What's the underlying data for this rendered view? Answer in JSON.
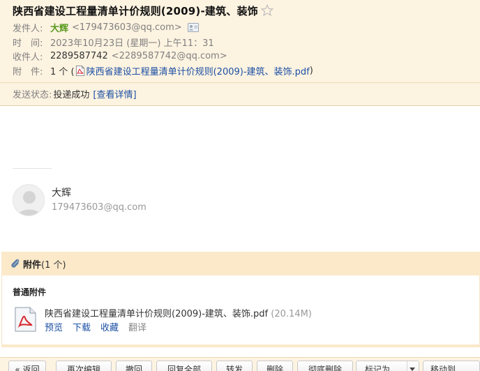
{
  "mail": {
    "subject": "陕西省建设工程量清单计价规则(2009)-建筑、装饰",
    "sender_label": "发件人:",
    "sender_name": "大辉",
    "sender_email": "<179473603@qq.com>",
    "time_label": "时　间:",
    "time_value": "2023年10月23日 (星期一) 上午11：31",
    "recipient_label": "收件人:",
    "recipient_name": "2289587742",
    "recipient_email": "<2289587742@qq.com>",
    "attachment_label": "附　件:",
    "attachment_count": "1 个 (",
    "attachment_name": "陕西省建设工程量清单计价规则(2009)-建筑、装饰.pdf",
    "attachment_close": ")",
    "status_label": "发送状态:",
    "status_value": "投递成功",
    "status_link": "[查看详情]"
  },
  "signature": {
    "name": "大辉",
    "email": "179473603@qq.com"
  },
  "attachments": {
    "title": "附件",
    "count": "(1 个)",
    "section": "普通附件",
    "file_name": "陕西省建设工程量清单计价规则(2009)-建筑、装饰.pdf",
    "file_size": "(20.14M)",
    "actions": {
      "preview": "预览",
      "download": "下载",
      "favorite": "收藏",
      "translate": "翻译"
    }
  },
  "toolbar": {
    "back": "« 返回",
    "edit_again": "再次编辑",
    "recall": "撤回",
    "reply_all": "回复全部",
    "forward": "转发",
    "delete": "删除",
    "delete_permanent": "彻底删除",
    "mark_as": "标记为...",
    "move_to": "移动到..."
  },
  "colors": {
    "header_bg": "#fdf3e1",
    "attachment_bar": "#fbe9c9",
    "link": "#1a4fa3",
    "sender_green": "#5a9a1f"
  }
}
